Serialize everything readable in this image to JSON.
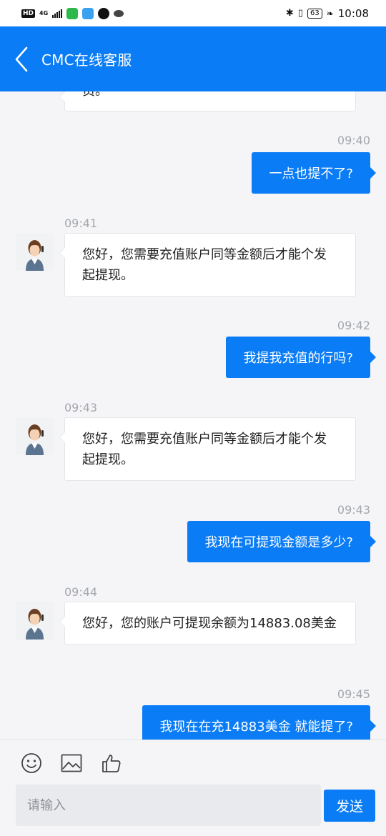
{
  "status_bar": {
    "left_badges": [
      "HD",
      "4G"
    ],
    "battery": "63",
    "time": "10:08"
  },
  "header": {
    "title": "CMC在线客服",
    "back_icon": "chevron-left-icon"
  },
  "messages": [
    {
      "side": "left",
      "text": "员。",
      "partial": true
    },
    {
      "side": "right",
      "time": "09:40",
      "text": "一点也提不了?"
    },
    {
      "side": "left",
      "time": "09:41",
      "text": "您好，您需要充值账户同等金额后才能个发起提现。"
    },
    {
      "side": "right",
      "time": "09:42",
      "text": "我提我充值的行吗?"
    },
    {
      "side": "left",
      "time": "09:43",
      "text": "您好，您需要充值账户同等金额后才能个发起提现。"
    },
    {
      "side": "right",
      "time": "09:43",
      "text": "我现在可提现金额是多少?"
    },
    {
      "side": "left",
      "time": "09:44",
      "text": "您好，您的账户可提现余额为14883.08美金"
    },
    {
      "side": "right",
      "time": "09:45",
      "text": "我现在在充14883美金 就能提了?"
    }
  ],
  "composer": {
    "tools": [
      "smiley-icon",
      "image-icon",
      "thumbs-up-icon"
    ],
    "placeholder": "请输入",
    "send_label": "发送"
  },
  "colors": {
    "brand": "#0a7cf5",
    "background": "#f5f5f7",
    "timestamp": "#a3a7ad"
  }
}
